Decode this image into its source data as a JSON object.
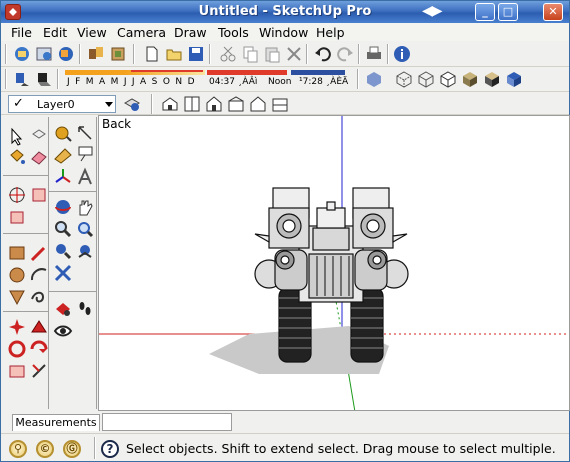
{
  "window": {
    "title": "Untitled - SketchUp Pro",
    "minimize": "_",
    "maximize": "□",
    "close": "✕",
    "nav_arrows": "◀▶"
  },
  "menu": {
    "items": [
      {
        "label": "File"
      },
      {
        "label": "Edit"
      },
      {
        "label": "View"
      },
      {
        "label": "Camera"
      },
      {
        "label": "Draw"
      },
      {
        "label": "Tools"
      },
      {
        "label": "Window"
      },
      {
        "label": "Help"
      }
    ]
  },
  "toolbar_standard": {
    "icons": [
      "get-models-icon",
      "share-model-icon",
      "share-component-icon",
      "get-photo-texture-icon",
      "google-earth-icon",
      "new-icon",
      "open-icon",
      "save-icon",
      "cut-icon",
      "copy-icon",
      "paste-icon",
      "erase-icon",
      "undo-icon",
      "redo-icon",
      "print-icon",
      "model-info-icon"
    ]
  },
  "shadows": {
    "months": "J F M A M J J A S O N D",
    "time_start": "04:37 ¸ÀÂì",
    "time_noon": "Noon",
    "time_end": "¹7:28 ¸ÀÈÄ",
    "accent_orange": "#f4a21d",
    "accent_red": "#e03b2a",
    "accent_blue": "#2c4fa0"
  },
  "styles_toolbar": {
    "icons": [
      "xray-icon",
      "back-edges-icon",
      "wireframe-icon",
      "hidden-line-icon",
      "shaded-icon",
      "shaded-textures-icon",
      "monochrome-icon"
    ]
  },
  "layers": {
    "current": "Layer0",
    "check": "✓"
  },
  "views_toolbar": {
    "icons": [
      "iso-view-icon",
      "top-view-icon",
      "front-view-icon",
      "right-view-icon",
      "back-view-icon",
      "left-view-icon"
    ]
  },
  "viewport": {
    "scene_label": "Back"
  },
  "measurements": {
    "label": "Measurements",
    "value": ""
  },
  "status": {
    "geo_1": "⚲",
    "geo_2": "©",
    "geo_3": "Ⓖ",
    "help": "?",
    "message": "Select objects. Shift to extend select. Drag mouse to select multiple."
  },
  "colors": {
    "axis_red": "#d22020",
    "axis_green": "#1a9a1a",
    "axis_blue": "#2020d0",
    "titlebar": "#3d6fc0"
  }
}
